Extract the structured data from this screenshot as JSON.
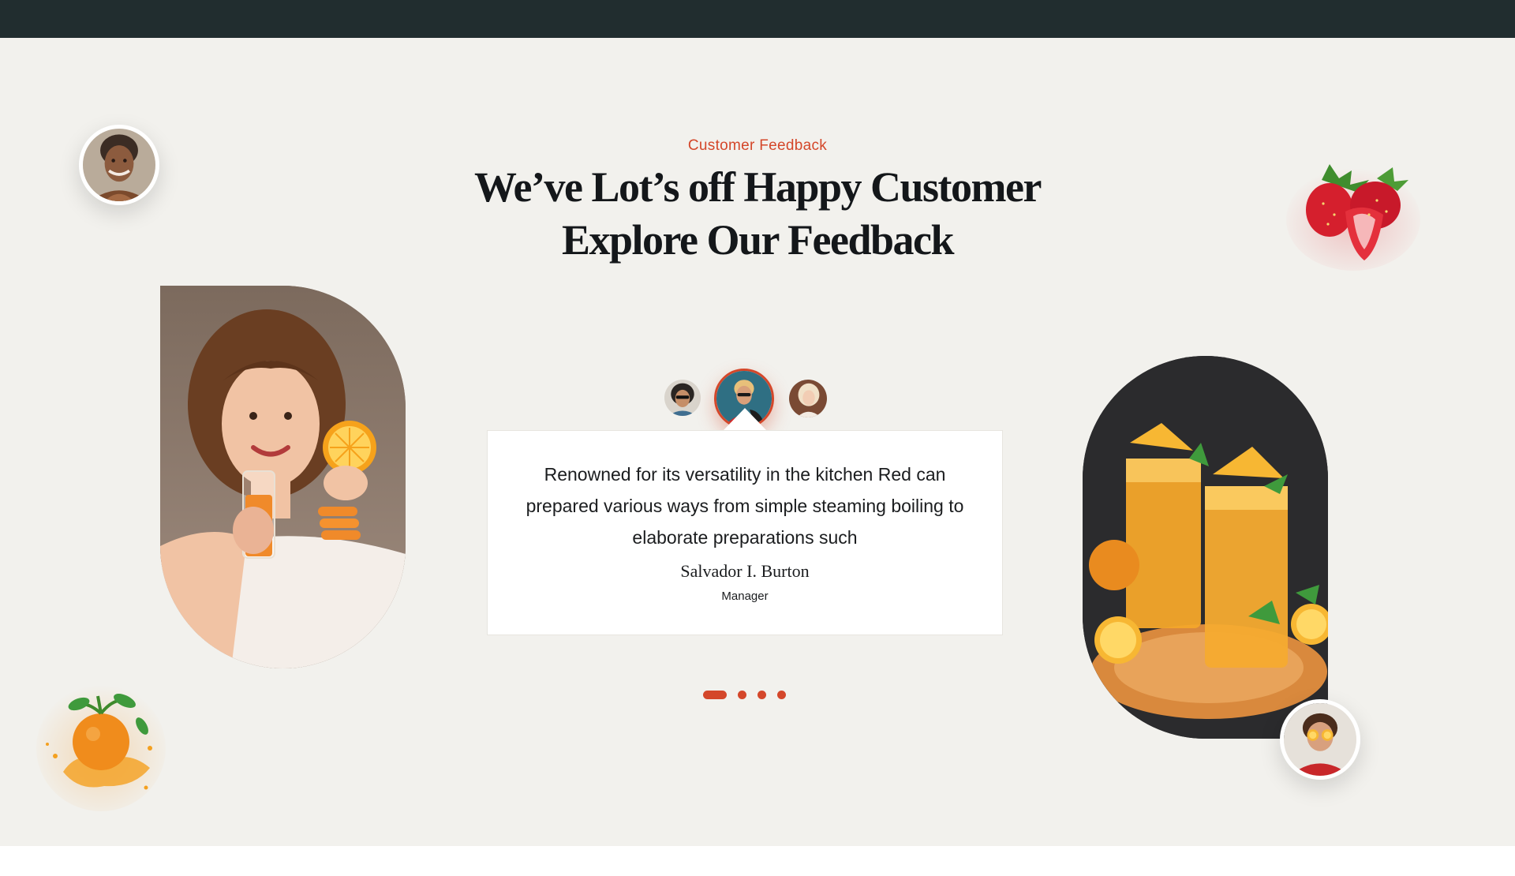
{
  "section": {
    "eyebrow": "Customer Feedback",
    "heading_line1": "We’ve Lot’s off Happy Customer",
    "heading_line2": "Explore Our Feedback"
  },
  "testimonial": {
    "quote": "Renowned for its versatility in the kitchen Red can prepared various ways from simple steaming boiling to elaborate preparations such",
    "author": "Salvador I. Burton",
    "role": "Manager"
  },
  "thumbnails": [
    {
      "icon": "man-sunglasses-avatar",
      "active": false
    },
    {
      "icon": "woman-red-shirt-avatar",
      "active": true
    },
    {
      "icon": "woman-blonde-avatar",
      "active": false
    }
  ],
  "pagination": {
    "count": 4,
    "active_index": 0
  },
  "colors": {
    "accent": "#d4472a",
    "topbar": "#212d2f",
    "section_bg": "#f2f1ed",
    "card_bg": "#ffffff",
    "text_dark": "#14171a"
  },
  "decor": {
    "top_left_avatar": "smiling-woman-avatar",
    "bottom_right_avatar": "woman-holding-oranges-avatar",
    "strawberry": "strawberry-icon",
    "orange": "orange-splash-icon",
    "left_image": "woman-with-orange-juice-photo",
    "right_image": "orange-juice-glasses-photo"
  }
}
